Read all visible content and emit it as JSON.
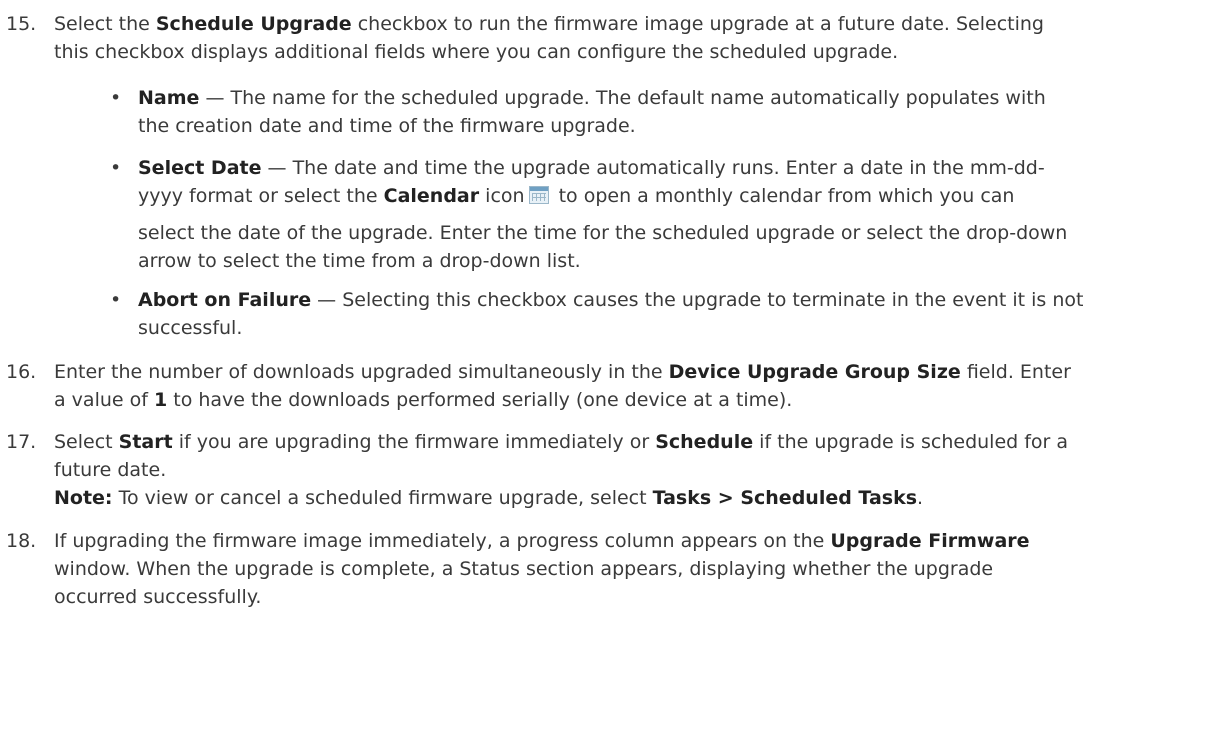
{
  "step15": {
    "number": "15.",
    "line1_pre": "Select the ",
    "line1_bold": "Schedule Upgrade",
    "line1_post": " checkbox to run the firmware image upgrade at a future date. Selecting",
    "line2": "this checkbox displays additional fields where you can configure the scheduled upgrade.",
    "bullets": [
      {
        "term": "Name",
        "line1": " — The name for the scheduled upgrade. The default name automatically populates with",
        "line2": "the creation date and time of the firmware upgrade."
      },
      {
        "term": "Select Date",
        "line1": " — The date and time the upgrade automatically runs. Enter a date in the mm-dd-",
        "line2_pre": "yyyy format or select the ",
        "line2_bold": "Calendar",
        "line2_mid": " icon",
        "line2_post": " to open a monthly calendar from which you can",
        "line3": "select the date of the upgrade. Enter the time for the scheduled upgrade or select the drop-down",
        "line4": "arrow to select the time from a drop-down list."
      },
      {
        "term": "Abort on Failure",
        "line1": " — Selecting this checkbox causes the upgrade to terminate in the event it is not",
        "line2": "successful."
      }
    ]
  },
  "step16": {
    "number": "16.",
    "line1_pre": "Enter the number of downloads upgraded simultaneously in the ",
    "line1_bold": "Device Upgrade Group Size",
    "line1_post": " field. Enter",
    "line2_pre": "a value of ",
    "line2_bold": "1",
    "line2_post": " to have the downloads performed serially (one device at a time)."
  },
  "step17": {
    "number": "17.",
    "line1_pre": "Select ",
    "line1_bold1": "Start",
    "line1_mid": " if you are upgrading the firmware immediately or ",
    "line1_bold2": "Schedule",
    "line1_post": " if the upgrade is scheduled for a",
    "line2": "future date.",
    "note_label": "Note:",
    "note_pre": " To view or cancel a scheduled firmware upgrade, select ",
    "note_bold": "Tasks > Scheduled Tasks",
    "note_post": "."
  },
  "step18": {
    "number": "18.",
    "line1_pre": "If upgrading the firmware image immediately, a progress column appears on the ",
    "line1_bold": "Upgrade Firmware",
    "line2": "window. When the upgrade is complete, a Status section appears, displaying whether the upgrade",
    "line3": "occurred successfully."
  },
  "icons": {
    "calendar": "calendar-icon"
  }
}
